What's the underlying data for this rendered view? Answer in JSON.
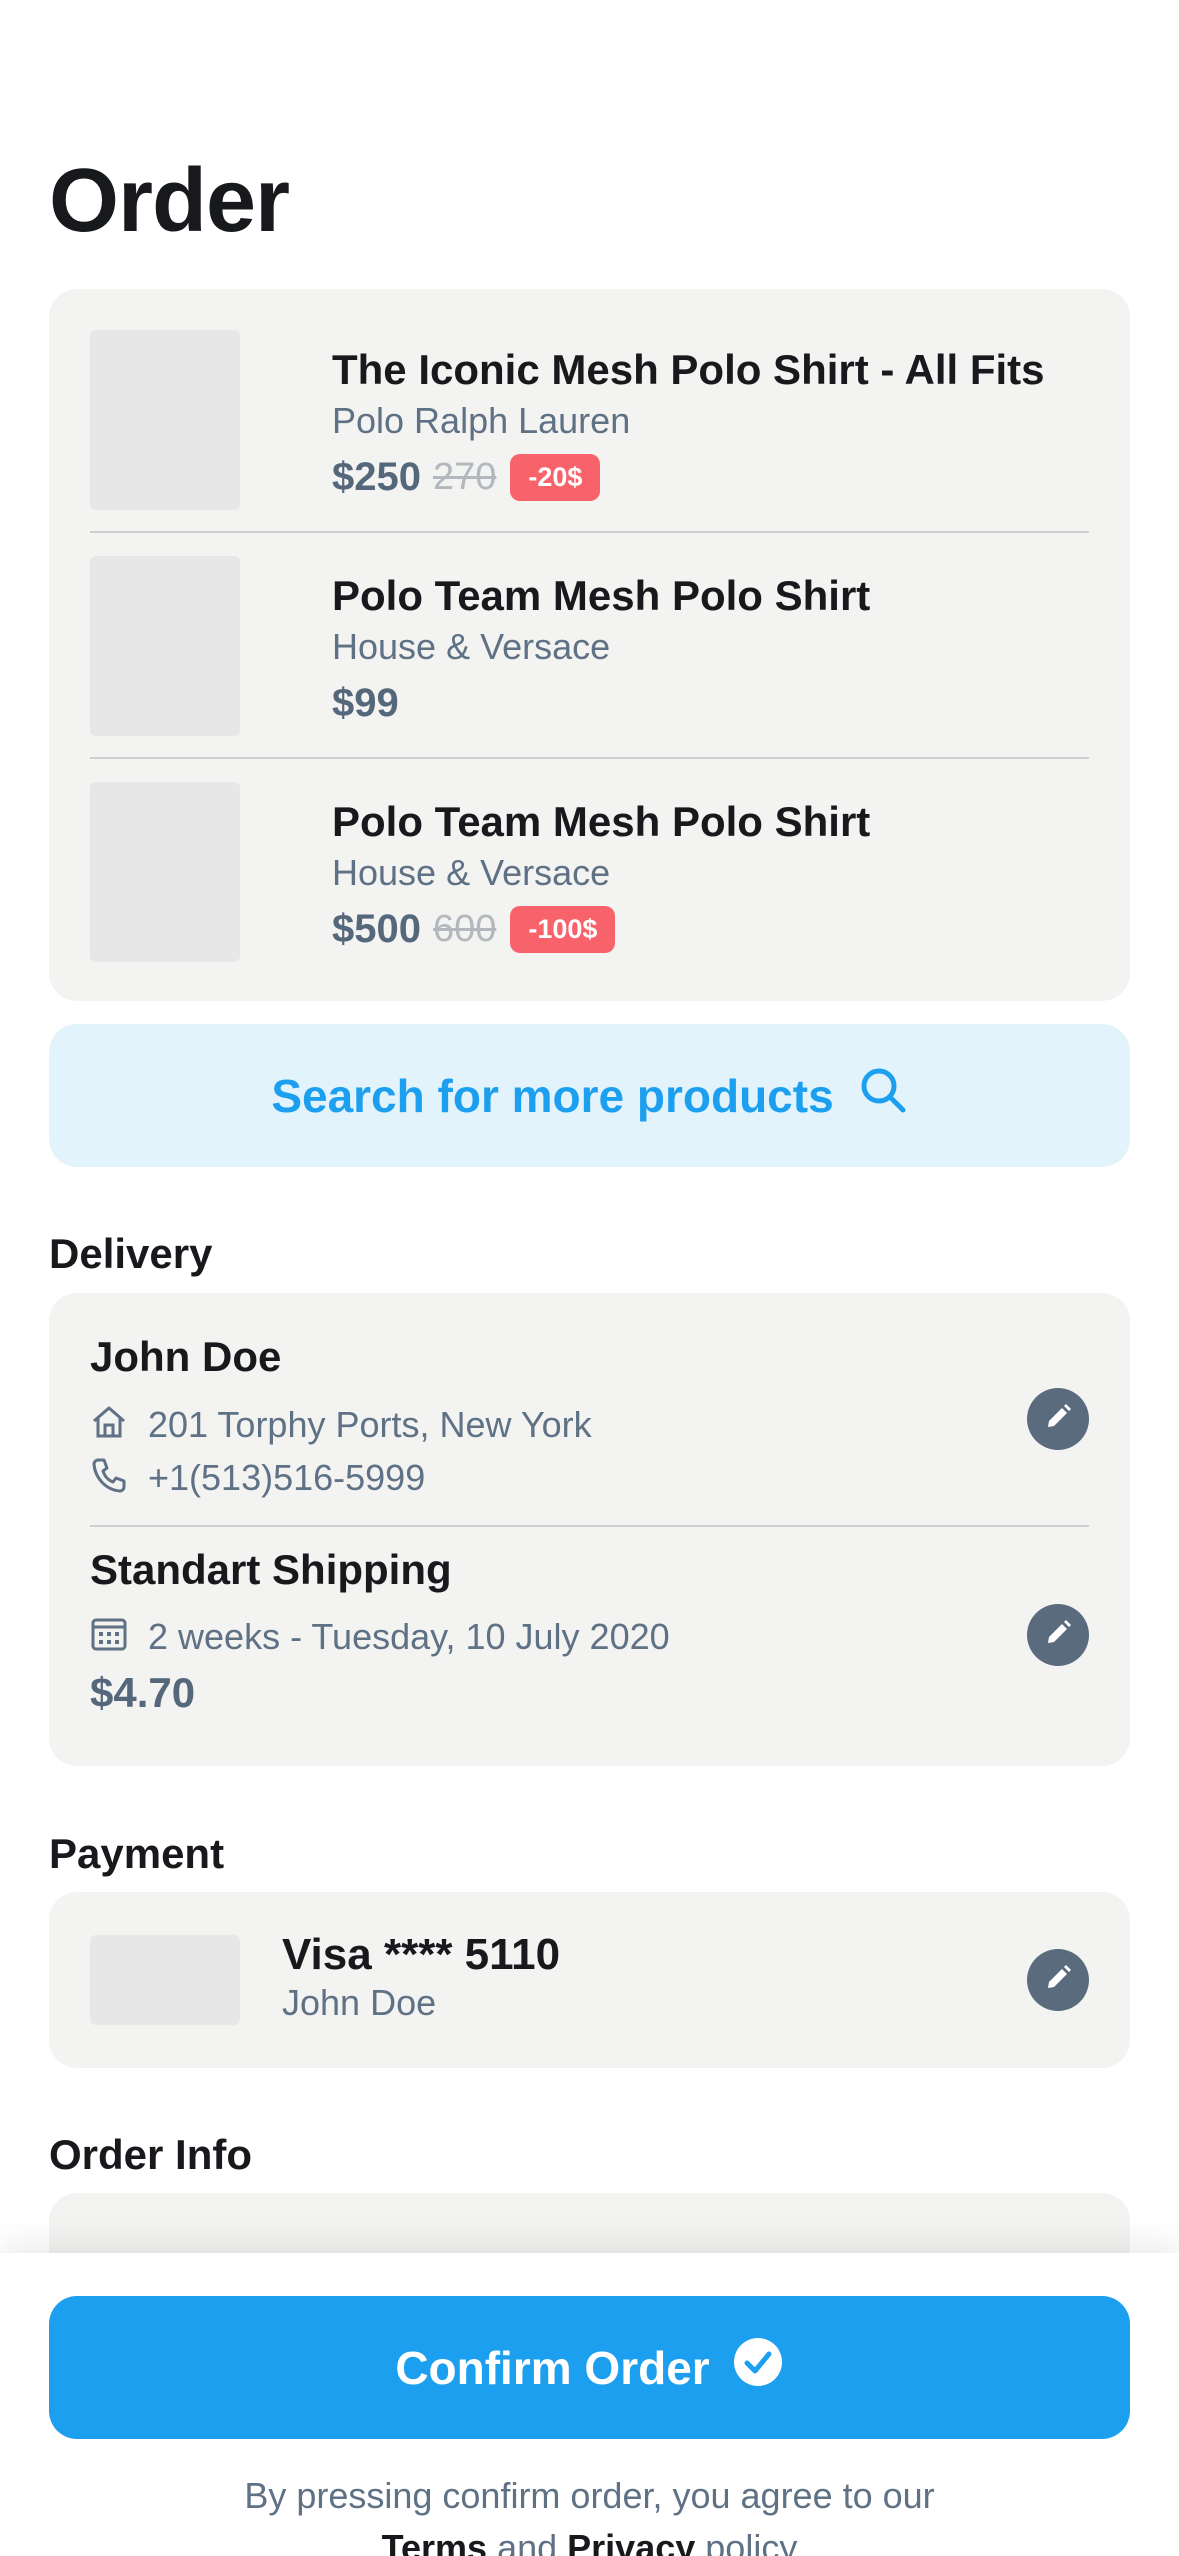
{
  "page": {
    "title": "Order"
  },
  "products": [
    {
      "name": "The Iconic Mesh Polo Shirt - All Fits",
      "brand": "Polo Ralph Lauren",
      "price": "$250",
      "old_price": "270",
      "discount": "-20$"
    },
    {
      "name": "Polo Team Mesh Polo Shirt",
      "brand": "House & Versace",
      "price": "$99",
      "old_price": "",
      "discount": ""
    },
    {
      "name": "Polo Team Mesh Polo Shirt",
      "brand": "House & Versace",
      "price": "$500",
      "old_price": "600",
      "discount": "-100$"
    }
  ],
  "search": {
    "label": "Search for more products",
    "icon": "search-icon"
  },
  "delivery": {
    "title": "Delivery",
    "name": "John Doe",
    "address": "201 Torphy Ports, New York",
    "phone": "+1(513)516-5999",
    "shipping_method": "Standart Shipping",
    "shipping_eta": "2 weeks - Tuesday, 10 July 2020",
    "shipping_price": "$4.70"
  },
  "payment": {
    "title": "Payment",
    "card": "Visa **** 5110",
    "holder": "John Doe"
  },
  "order_info": {
    "title": "Order Info"
  },
  "footer": {
    "confirm_label": "Confirm Order",
    "agree_prefix": "By pressing confirm order, you agree to our",
    "terms": "Terms",
    "and": "and",
    "privacy": "Privacy",
    "policy": "policy"
  },
  "colors": {
    "accent": "#1d9ff0",
    "badge": "#f8626a",
    "card_bg": "#f3f3f2",
    "muted": "#5f7184"
  }
}
